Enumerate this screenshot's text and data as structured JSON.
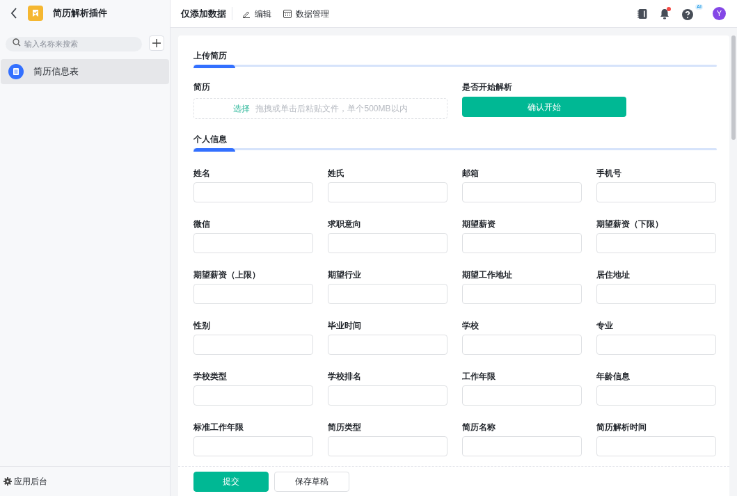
{
  "app": {
    "title": "简历解析插件"
  },
  "sidebar": {
    "search": {
      "placeholder": "输入名称来搜索"
    },
    "items": [
      {
        "label": "简历信息表",
        "selected": true
      }
    ],
    "footer": "应用后台"
  },
  "toolbar": {
    "mode": "仅添加数据",
    "actions": [
      {
        "label": "编辑",
        "kind": "edit"
      },
      {
        "label": "数据管理",
        "kind": "table"
      }
    ],
    "notification_dot": true,
    "ai_badge": "AI",
    "avatar": "Y"
  },
  "sections": [
    {
      "title": "上传简历",
      "kind": "upload",
      "upload": {
        "label": "简历",
        "link": "选择",
        "hint": "拖拽或单击后粘贴文件，单个500MB以内"
      },
      "action": {
        "label": "是否开始解析",
        "button": "确认开始"
      }
    },
    {
      "title": "个人信息",
      "kind": "fields",
      "fields": [
        {
          "label": "姓名"
        },
        {
          "label": "姓氏"
        },
        {
          "label": "邮箱"
        },
        {
          "label": "手机号"
        },
        {
          "label": "微信"
        },
        {
          "label": "求职意向"
        },
        {
          "label": "期望薪资"
        },
        {
          "label": "期望薪资（下限）"
        },
        {
          "label": "期望薪资（上限）"
        },
        {
          "label": "期望行业"
        },
        {
          "label": "期望工作地址"
        },
        {
          "label": "居住地址"
        },
        {
          "label": "性别"
        },
        {
          "label": "毕业时间"
        },
        {
          "label": "学校"
        },
        {
          "label": "专业"
        },
        {
          "label": "学校类型"
        },
        {
          "label": "学校排名"
        },
        {
          "label": "工作年限"
        },
        {
          "label": "年龄信息"
        },
        {
          "label": "标准工作年限"
        },
        {
          "label": "简历类型"
        },
        {
          "label": "简历名称"
        },
        {
          "label": "简历解析时间"
        }
      ]
    }
  ],
  "footer": {
    "buttons": [
      {
        "label": "提交",
        "kind": "primary"
      },
      {
        "label": "保存草稿",
        "kind": "secondary"
      }
    ]
  }
}
